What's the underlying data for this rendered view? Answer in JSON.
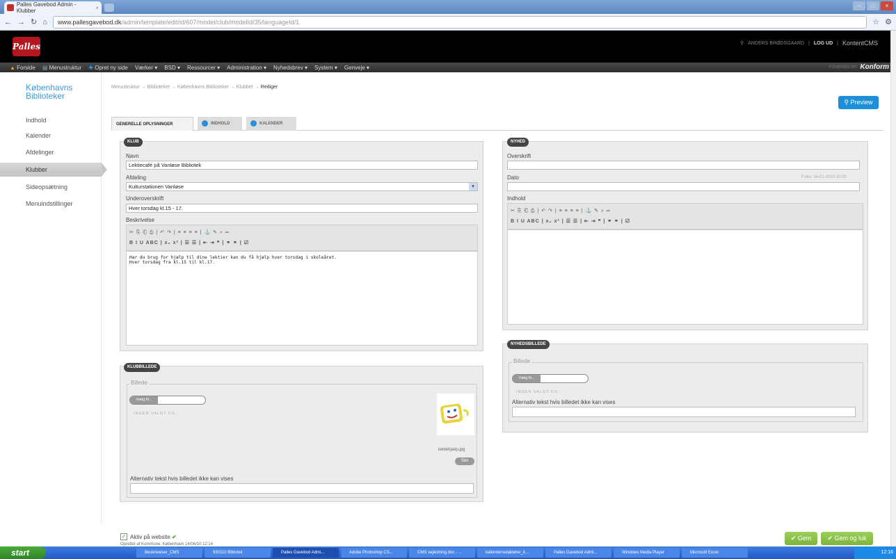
{
  "browser": {
    "tab_title": "Palles Gavebod Admin - Klubber",
    "url_host": "www.pallesgavebod.dk",
    "url_path": "/admin/template/edit/id/607/model/club/modelId/35/languageId/1"
  },
  "header": {
    "logo": "Palles",
    "user": "ANDERS BRØDSGAARD",
    "logout": "LOG UD",
    "brand": "KontentCMS"
  },
  "menu": {
    "items": [
      "Forside",
      "Menustruktur",
      "Opret ny side",
      "Værker ▾",
      "BSD ▾",
      "Ressourcer ▾",
      "Administration ▾",
      "Nyhedsbrev ▾",
      "System ▾",
      "Genveje ▾"
    ],
    "powered": "POWERED BY",
    "powered_brand": "Konform"
  },
  "sidebar": {
    "site": "Københavns Biblioteker",
    "items": [
      "Indhold",
      "Kalender",
      "Afdelinger",
      "Klubber",
      "Sideopsætning",
      "Menuindstillinger"
    ]
  },
  "breadcrumb": {
    "path": "Menustruktur → Biblioteket → Københavns Biblioteker → Klubber → ",
    "current": "Rediger"
  },
  "preview_label": "Preview",
  "tabs": [
    "GENERELLE OPLYSNINGER",
    "INDHOLD",
    "KALENDER"
  ],
  "club": {
    "title": "KLUB",
    "name_label": "Navn",
    "name_value": "Lektiecafé på Vanløse Bibliotek",
    "dept_label": "Afdeling",
    "dept_value": "Kulturstationen Vanløse",
    "sub_label": "Underoverskrift",
    "sub_value": "Hver torsdag kl.15 - 17.",
    "desc_label": "Beskrivelse",
    "desc_line1": "Har du brug for hjælp til dine lektier kan du få hjælp hver torsdag i skoleåret.",
    "desc_line2": "Hver torsdag fra kl.15 til kl.17."
  },
  "toolbar": {
    "row1": "✂ ⎘ ⎗ ⎙ | ↶ ↷ | ≡ ≡ ≡ ≡ | ⚓ ✎ ⌕ ═",
    "row2": "B I U ABC | x₂ x² | ☰ ☰ | ⇤ ⇥ ❝ | ⚭ ⚭ | ☑"
  },
  "clubimage": {
    "title": "KLUBBILLEDE",
    "legend": "Billede",
    "choose": "Vælg fil...",
    "hint": "INGEN VALGT FIL",
    "filename": "lektiehjælp.jpg",
    "delete": "Slet",
    "alt_label": "Alternativ tekst hvis billedet ikke kan vises"
  },
  "news": {
    "title": "NYHED",
    "heading_label": "Overskrift",
    "date_label": "Dato",
    "date_hint": "F.eks: 14-01-2010 10:30",
    "content_label": "Indhold"
  },
  "newsimage": {
    "title": "NYHEDSBILLEDE",
    "legend": "Billede",
    "choose": "Vælg fil...",
    "hint": "INGEN VALGT FIL",
    "alt_label": "Alternativ tekst hvis billedet ikke kan vises"
  },
  "footer": {
    "active_label": "Aktiv på website",
    "created": "Oprettet af Kommune: København 14/06/10 12:14",
    "save": "Gem",
    "save_close": "Gem og luk"
  },
  "taskbar": {
    "start": "start",
    "tasks": [
      "Beskrivelser_CMS",
      "930110 Biblotek",
      "Palles Gavebod Admi...",
      "Adobe Photoshop CS...",
      "CMS vejledning.doc - ...",
      "kalenderredaktører_k...",
      "Palles Gavebod Admi...",
      "Windows Media Player",
      "Microsoft Excel"
    ],
    "clock": "12:16"
  }
}
